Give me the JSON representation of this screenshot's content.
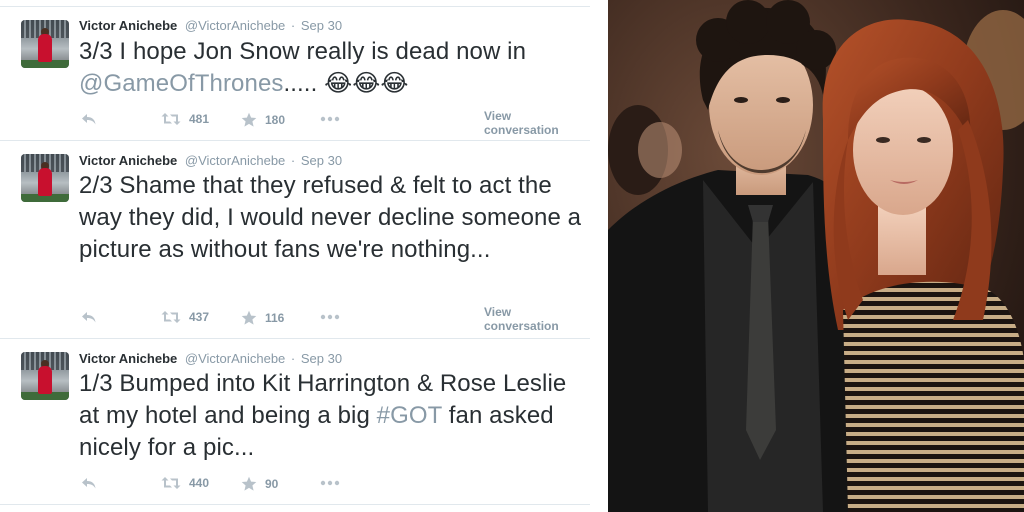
{
  "tweets": [
    {
      "author_name": "Victor Anichebe",
      "handle": "@VictorAnichebe",
      "separator": "·",
      "date": "Sep 30",
      "text_before_link": "3/3 I hope Jon Snow really is dead now in ",
      "link_text": "@GameOfThrones",
      "text_after_link": "..... 😂😂😂",
      "retweets": "481",
      "favorites": "180",
      "view_conversation": "View conversation"
    },
    {
      "author_name": "Victor Anichebe",
      "handle": "@VictorAnichebe",
      "separator": "·",
      "date": "Sep 30",
      "text": "2/3 Shame that they refused & felt to act the way they did, I would never decline someone a picture as without fans we're nothing...",
      "retweets": "437",
      "favorites": "116",
      "view_conversation": "View conversation"
    },
    {
      "author_name": "Victor Anichebe",
      "handle": "@VictorAnichebe",
      "separator": "·",
      "date": "Sep 30",
      "text_before_link": "1/3 Bumped into Kit Harrington & Rose Leslie at my hotel and being a big ",
      "link_text": "#GOT",
      "text_after_link": " fan asked nicely for a pic...",
      "retweets": "440",
      "favorites": "90"
    }
  ],
  "icons": {
    "reply": "reply-icon",
    "retweet": "retweet-icon",
    "favorite": "star-icon",
    "more": "more-icon"
  },
  "colors": {
    "text": "#292f33",
    "muted": "#8899a6",
    "link": "#8899a6",
    "divider": "#e1e8ed"
  }
}
